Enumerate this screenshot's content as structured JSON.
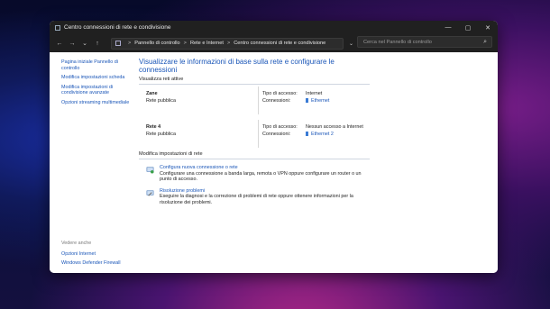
{
  "window": {
    "title": "Centro connessioni di rete e condivisione"
  },
  "titlebar_buttons": {
    "minimize": "—",
    "maximize": "▢",
    "close": "✕"
  },
  "nav": {
    "back": "←",
    "forward": "→",
    "dropdown": "⌄",
    "up": "↑"
  },
  "address": {
    "crumbs": [
      "Pannello di controllo",
      "Rete e Internet",
      "Centro connessioni di rete e condivisione"
    ],
    "sep": ">",
    "dropdown": "⌄",
    "refresh": "↻"
  },
  "search": {
    "placeholder": "Cerca nel Pannello di controllo",
    "icon": "⌕"
  },
  "sidebar": {
    "items": [
      {
        "label": "Pagina iniziale Pannello di controllo"
      },
      {
        "label": "Modifica impostazioni scheda"
      },
      {
        "label": "Modifica impostazioni di condivisione avanzate"
      },
      {
        "label": "Opzioni streaming multimediale"
      }
    ],
    "see_also": {
      "header": "Vedere anche",
      "links": [
        {
          "label": "Opzioni Internet"
        },
        {
          "label": "Windows Defender Firewall"
        }
      ]
    }
  },
  "main": {
    "heading": "Visualizzare le informazioni di base sulla rete e configurare le connessioni",
    "active_networks_header": "Visualizza reti attive",
    "networks": [
      {
        "name": "Zane",
        "type": "Rete pubblica",
        "access_label": "Tipo di accesso:",
        "access": "Internet",
        "conn_label": "Connessioni:",
        "connection": "Ethernet"
      },
      {
        "name": "Rete 4",
        "type": "Rete pubblica",
        "access_label": "Tipo di accesso:",
        "access": "Nessun accesso a Internet",
        "conn_label": "Connessioni:",
        "connection": "Ethernet 2"
      }
    ],
    "settings_header": "Modifica impostazioni di rete",
    "tasks": [
      {
        "title": "Configura nuova connessione o rete",
        "desc": "Configurare una connessione a banda larga, remota o VPN oppure configurare un router o un punto di accesso."
      },
      {
        "title": "Risoluzione problemi",
        "desc": "Eseguire la diagnosi e la correzione di problemi di rete oppure ottenere informazioni per la risoluzione dei problemi."
      }
    ]
  }
}
